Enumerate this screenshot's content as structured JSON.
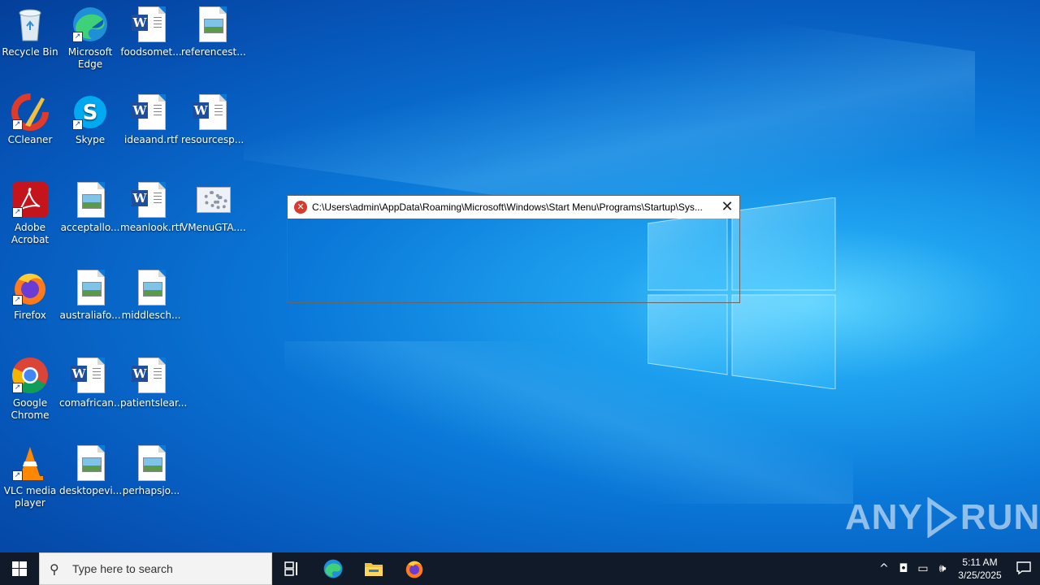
{
  "desktop": {
    "icons": [
      {
        "label": "Recycle Bin"
      },
      {
        "label": "Microsoft Edge"
      },
      {
        "label": "foodsomet..."
      },
      {
        "label": "referencest..."
      },
      {
        "label": "CCleaner"
      },
      {
        "label": "Skype"
      },
      {
        "label": "ideaand.rtf"
      },
      {
        "label": "resourcesp..."
      },
      {
        "label": "Adobe Acrobat"
      },
      {
        "label": "acceptallo..."
      },
      {
        "label": "meanlook.rtf"
      },
      {
        "label": "VMenuGTA...."
      },
      {
        "label": "Firefox"
      },
      {
        "label": "australiafo..."
      },
      {
        "label": "middlesch..."
      },
      {
        "label": "Google Chrome"
      },
      {
        "label": "comafrican..."
      },
      {
        "label": "patientslear..."
      },
      {
        "label": "VLC media player"
      },
      {
        "label": "desktopevi..."
      },
      {
        "label": "perhapsjo..."
      }
    ]
  },
  "dialog": {
    "title": "C:\\Users\\admin\\AppData\\Roaming\\Microsoft\\Windows\\Start Menu\\Programs\\Startup\\Sys...",
    "close_glyph": "✕"
  },
  "watermark": {
    "left": "ANY",
    "right": "RUN"
  },
  "taskbar": {
    "search_placeholder": "Type here to search",
    "clock_time": "5:11 AM",
    "clock_date": "3/25/2025"
  }
}
